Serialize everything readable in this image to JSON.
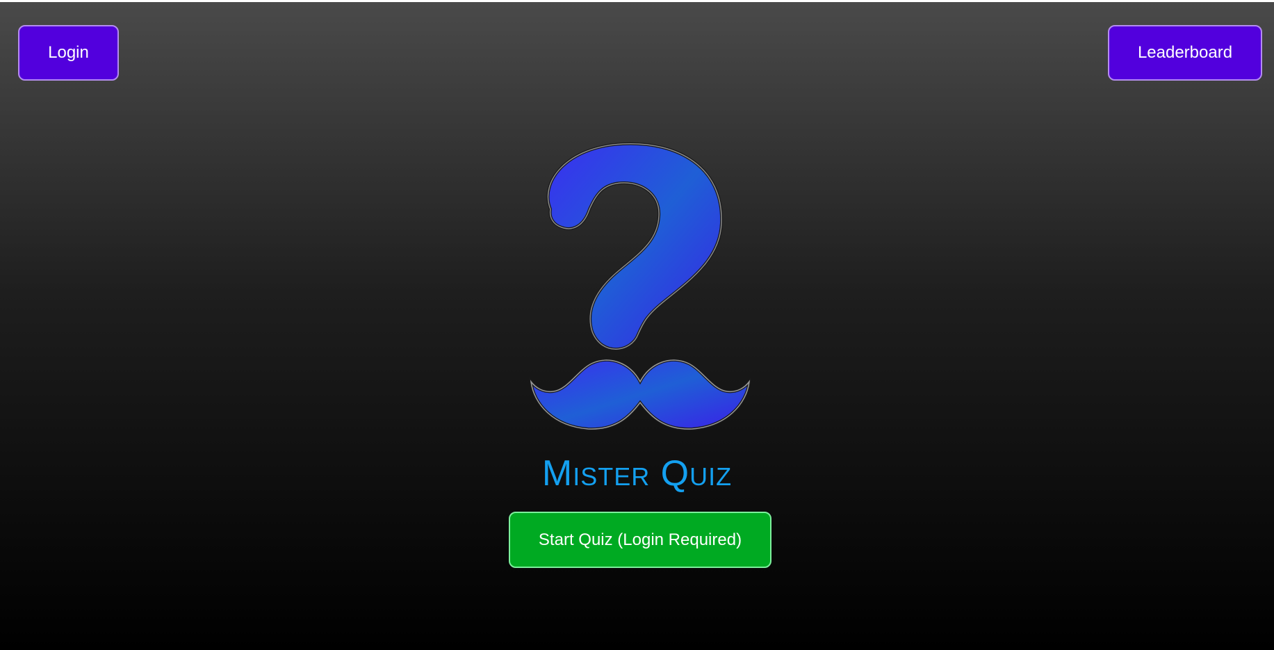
{
  "header": {
    "login_label": "Login",
    "leaderboard_label": "Leaderboard"
  },
  "logo": {
    "icon": "question-mark-mustache-icon",
    "color": "#2b3fe0"
  },
  "main": {
    "title": "Mister Quiz",
    "start_label": "Start Quiz (Login Required)"
  },
  "colors": {
    "button_purple": "#5200dd",
    "button_green": "#00aa22",
    "title_blue": "#14a0f0"
  }
}
